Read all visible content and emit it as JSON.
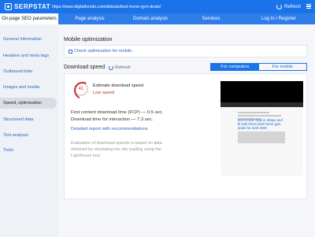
{
  "topbar": {
    "logo": "SERPSTAT",
    "url": "https://www.digitaltrends.com/dtdeals/best-home-gym-deals/",
    "refresh_label": "Refresh"
  },
  "tabs": [
    {
      "label": "On-page SEO parameters",
      "active": true
    },
    {
      "label": "Page analysis"
    },
    {
      "label": "Domain analysis"
    },
    {
      "label": "Services"
    },
    {
      "label": "Log In / Register"
    }
  ],
  "sidebar": {
    "items": [
      {
        "label": "General information"
      },
      {
        "label": "Headers and meta tags"
      },
      {
        "label": "Outbound links"
      },
      {
        "label": "Images and media"
      },
      {
        "label": "Speed, optimization",
        "active": true
      },
      {
        "label": "Structured data"
      },
      {
        "label": "Text analysis"
      },
      {
        "label": "Tools"
      }
    ]
  },
  "mobile": {
    "title": "Mobile optimization",
    "link": "Check optimization for mobile."
  },
  "speed": {
    "title": "Download speed",
    "refresh_label": "Refresh",
    "toggle": {
      "computers": "For computers",
      "mobile": "For mobile"
    },
    "score": "41",
    "estimate_label": "Estimate download speed",
    "estimate_value": "Low speed",
    "fcp": "First content download time (FCP) — 0.5 sec.",
    "interaction": "Download time for interaction — 7.3 sec.",
    "details_link": "Detailed report with recommendations",
    "note": "Evaluation of download speeds is based on data obtained by simulating the site loading using the Lighthouse tool."
  },
  "thumbnail": {
    "headline": "Don't miss! Stay in shape and fit with these best home gym deals for April 2020"
  },
  "colors": {
    "brand": "#1a73e8",
    "low_speed": "#c43030",
    "link": "#2a67c9"
  }
}
